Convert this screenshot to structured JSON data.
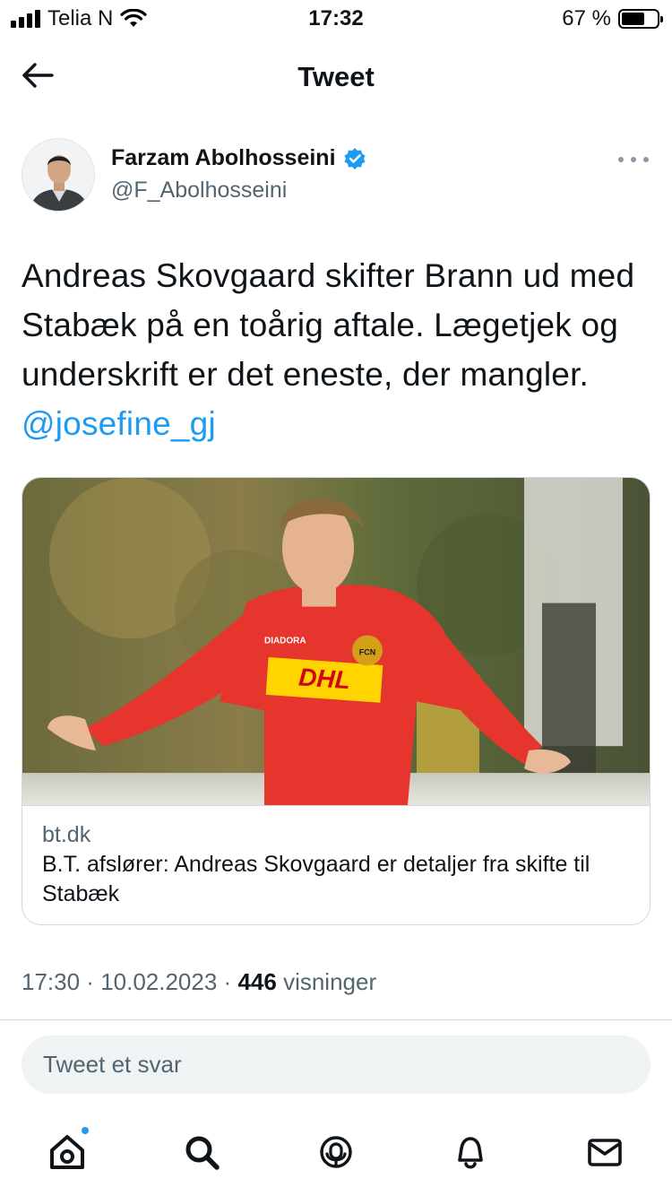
{
  "status_bar": {
    "carrier": "Telia N",
    "time": "17:32",
    "battery_percent": "67 %",
    "battery_level": 0.67
  },
  "header": {
    "title": "Tweet",
    "back_icon": "arrow-left-icon"
  },
  "author": {
    "name": "Farzam Abolhosseini",
    "handle": "@F_Abolhosseini",
    "verified": true,
    "verified_color": "#1d9bf0"
  },
  "tweet": {
    "text": "Andreas Skovgaard skifter Brann ud med Stabæk på en toårig aftale. Lægetjek og underskrift er det eneste, der mangler.",
    "mention": "@josefine_gj",
    "mention_color": "#1d9bf0"
  },
  "card": {
    "domain": "bt.dk",
    "title": "B.T. afslører: Andreas Skovgaard er detaljer fra skifte til Stabæk",
    "image_lettering": [
      "DIADORA",
      "DHL",
      "FCN"
    ]
  },
  "meta": {
    "time": "17:30",
    "separator": " · ",
    "date": "10.02.2023",
    "views_count": "446",
    "views_label": "visninger"
  },
  "reply": {
    "placeholder": "Tweet et svar"
  },
  "tabbar": {
    "items": [
      {
        "icon": "home-icon",
        "has_badge": true
      },
      {
        "icon": "search-icon"
      },
      {
        "icon": "spaces-icon"
      },
      {
        "icon": "bell-icon"
      },
      {
        "icon": "mail-icon"
      }
    ]
  }
}
